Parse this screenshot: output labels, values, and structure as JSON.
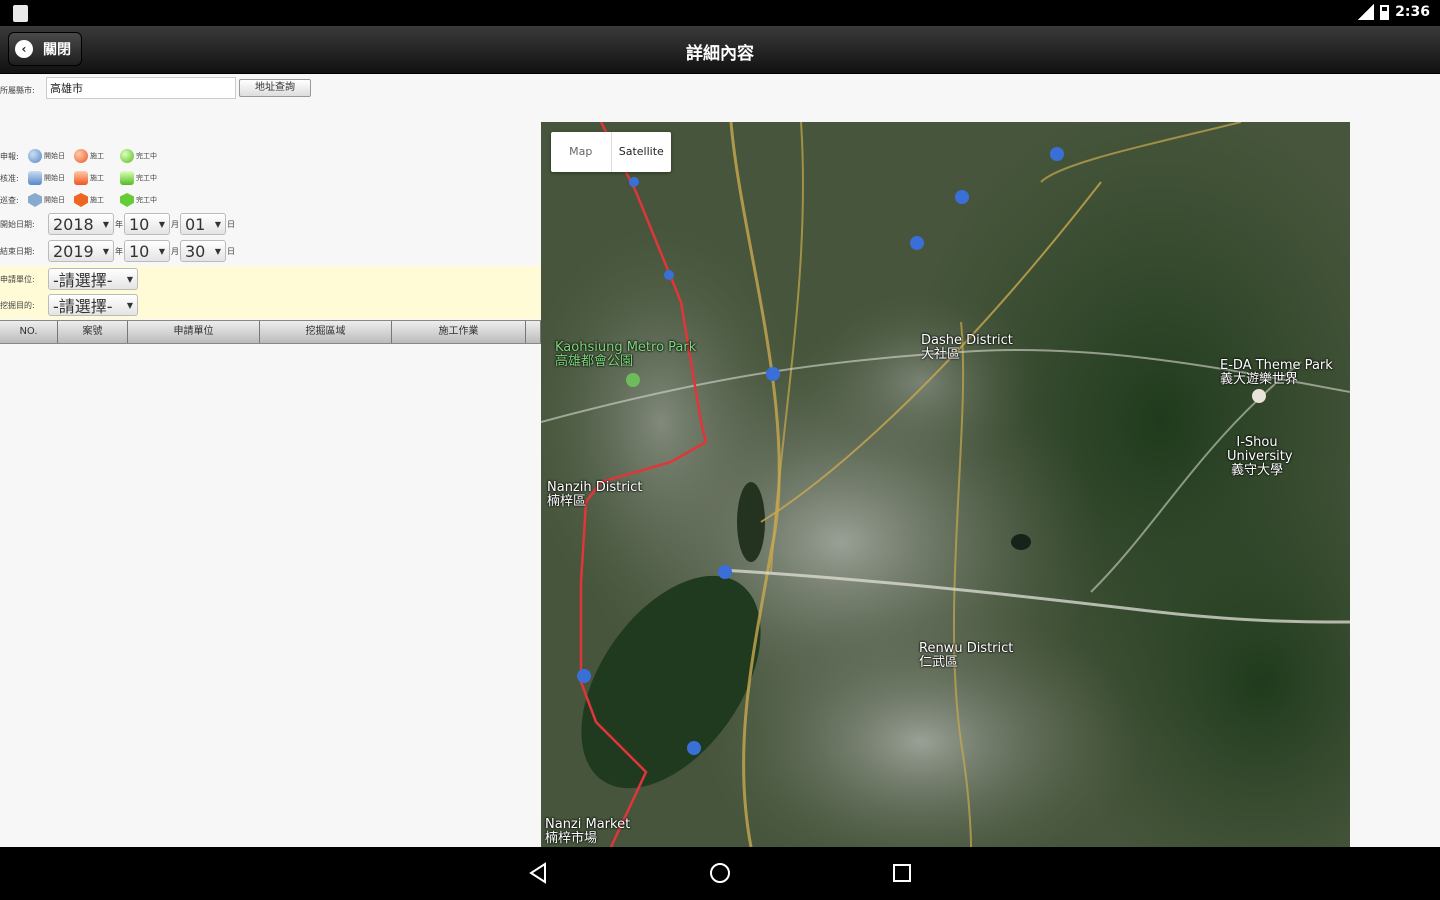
{
  "status_bar": {
    "time": "2:36"
  },
  "header": {
    "back_label": "關閉",
    "title": "詳細內容"
  },
  "address": {
    "label": "所屬縣市:",
    "value": "高雄市",
    "button": "地址查詢"
  },
  "legend": {
    "rows": [
      {
        "label": "申報:",
        "shape": "c",
        "items": [
          "開始日",
          "施工",
          "完工中"
        ]
      },
      {
        "label": "核准:",
        "shape": "s",
        "items": [
          "開始日",
          "施工",
          "完工中"
        ]
      },
      {
        "label": "巡查:",
        "shape": "sh",
        "items": [
          "開始日",
          "施工",
          "完工中"
        ]
      }
    ]
  },
  "date_start": {
    "label": "開始日期:",
    "year": "2018",
    "month": "10",
    "day": "01",
    "u_year": "年",
    "u_month": "月",
    "u_day": "日"
  },
  "date_end": {
    "label": "結束日期:",
    "year": "2019",
    "month": "10",
    "day": "30",
    "u_year": "年",
    "u_month": "月",
    "u_day": "日"
  },
  "filters": [
    {
      "label": "申請單位:",
      "value": "-請選擇-"
    },
    {
      "label": "挖掘目的:",
      "value": "-請選擇-"
    }
  ],
  "table": {
    "headers": [
      "NO.",
      "案號",
      "申請單位",
      "挖掘區域",
      "施工作業"
    ]
  },
  "map": {
    "type_map": "Map",
    "type_satellite": "Satellite",
    "labels": [
      {
        "text": "Kaohsiung Metro Park",
        "sub": "高雄都會公園",
        "green": true
      },
      {
        "text": "Dashe District",
        "sub": "大社區",
        "green": false
      },
      {
        "text": "E-DA Theme Park",
        "sub": "義大遊樂世界",
        "green": false
      },
      {
        "text": "I-Shou University",
        "sub": "義守大學",
        "green": false
      },
      {
        "text": "Renwu District",
        "sub": "仁武區",
        "green": false
      },
      {
        "text": "Nanzih District",
        "sub": "楠梓區",
        "green": false
      },
      {
        "text": "Nanzi Market",
        "sub": "楠梓市場",
        "green": false
      }
    ]
  }
}
